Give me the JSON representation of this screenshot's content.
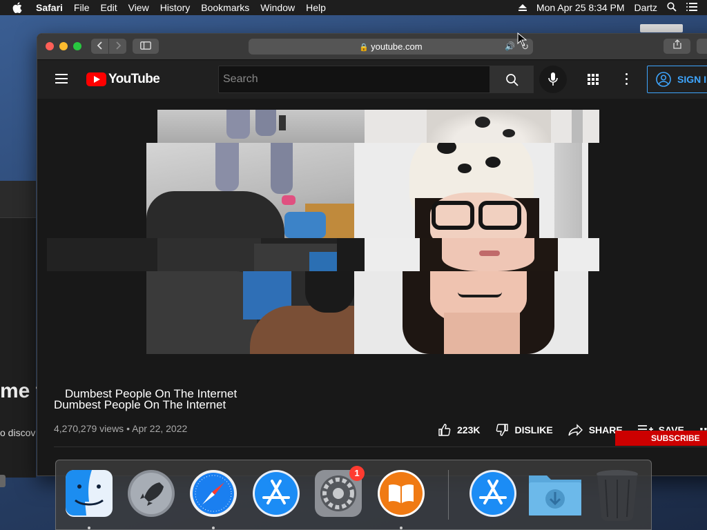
{
  "menubar": {
    "app_name": "Safari",
    "menus": [
      "File",
      "Edit",
      "View",
      "History",
      "Bookmarks",
      "Window",
      "Help"
    ],
    "datetime": "Mon Apr 25  8:34 PM",
    "user": "Dartz"
  },
  "background": {
    "heading_fragment": "me to",
    "text_fragment": "o discov",
    "subscribe_fragment": "SUBSCRIBE"
  },
  "browser": {
    "url": "youtube.com"
  },
  "youtube": {
    "logo_text": "YouTube",
    "search_placeholder": "Search",
    "sign_in_label": "SIGN IN",
    "video": {
      "title": "Dumbest People On The Internet",
      "views": "4,270,279 views",
      "date": "Apr 22, 2022",
      "likes": "223K",
      "dislike_label": "DISLIKE",
      "share_label": "SHARE",
      "save_label": "SAVE"
    }
  },
  "dock": {
    "apps": [
      "Finder",
      "Launchpad",
      "Safari",
      "App Store",
      "System Preferences",
      "Books",
      "App Store",
      "Downloads",
      "Trash"
    ],
    "system_preferences_badge": "1"
  },
  "colors": {
    "youtube_red": "#ff0000",
    "link_blue": "#3ea6ff",
    "badge_red": "#ff3b30"
  }
}
